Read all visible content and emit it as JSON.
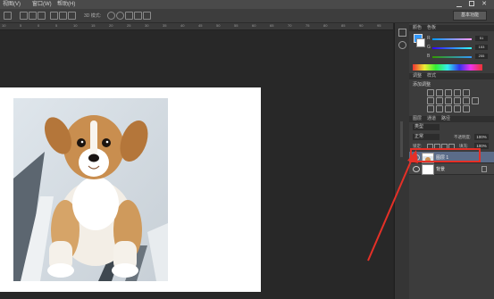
{
  "menubar": {
    "items": [
      "视图(V)",
      "窗口(W)",
      "帮助(H)"
    ]
  },
  "options_bar": {
    "mode_label": "3D 模式:",
    "workspace": "基本功能"
  },
  "ruler": {
    "ticks": [
      "10",
      "5",
      "0",
      "5",
      "10",
      "15",
      "20",
      "25",
      "30",
      "35",
      "40",
      "45",
      "50",
      "55",
      "60",
      "65",
      "70",
      "75",
      "80",
      "85",
      "90",
      "95"
    ]
  },
  "color_panel": {
    "tabs": [
      "颜色",
      "色板"
    ],
    "channels": [
      {
        "label": "R",
        "value": "51"
      },
      {
        "label": "G",
        "value": "153"
      },
      {
        "label": "B",
        "value": "255"
      }
    ]
  },
  "adjustments_panel": {
    "tabs": [
      "调整",
      "样式"
    ],
    "title": "添加调整"
  },
  "layers_panel": {
    "tabs": [
      "图层",
      "通道",
      "路径"
    ],
    "kind_label": "类型",
    "blend_mode": "正常",
    "opacity_label": "不透明度:",
    "opacity_value": "100%",
    "lock_label": "锁定:",
    "fill_label": "填充:",
    "fill_value": "100%",
    "layers": [
      {
        "name": "图层 1",
        "selected": true
      },
      {
        "name": "背景",
        "selected": false
      }
    ]
  },
  "colors": {
    "highlight": "#e53027",
    "selected_layer": "#5b6c89"
  }
}
